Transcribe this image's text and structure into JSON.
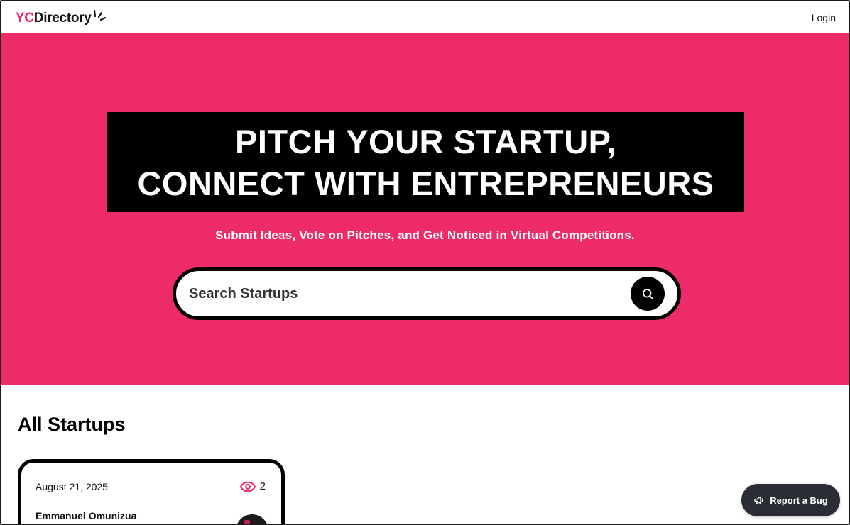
{
  "navbar": {
    "logo_prefix": "YC",
    "logo_rest": "Directory",
    "login_label": "Login"
  },
  "hero": {
    "headline_line1": "PITCH YOUR STARTUP,",
    "headline_line2": "CONNECT WITH ENTREPRENEURS",
    "subtitle": "Submit Ideas, Vote on Pitches, and Get Noticed in Virtual Competitions.",
    "search": {
      "placeholder": "Search Startups",
      "button_icon": "search-icon"
    }
  },
  "section": {
    "title": "All Startups"
  },
  "startups": [
    {
      "date": "August 21, 2025",
      "views": "2",
      "views_icon": "eye-icon",
      "author": "Emmanuel Omunizua"
    }
  ],
  "report_bug": {
    "label": "Report a Bug",
    "icon": "megaphone-icon"
  },
  "colors": {
    "primary": "#EE2B69",
    "black": "#000000",
    "white": "#FFFFFF",
    "report_bg": "#2A2D33"
  }
}
